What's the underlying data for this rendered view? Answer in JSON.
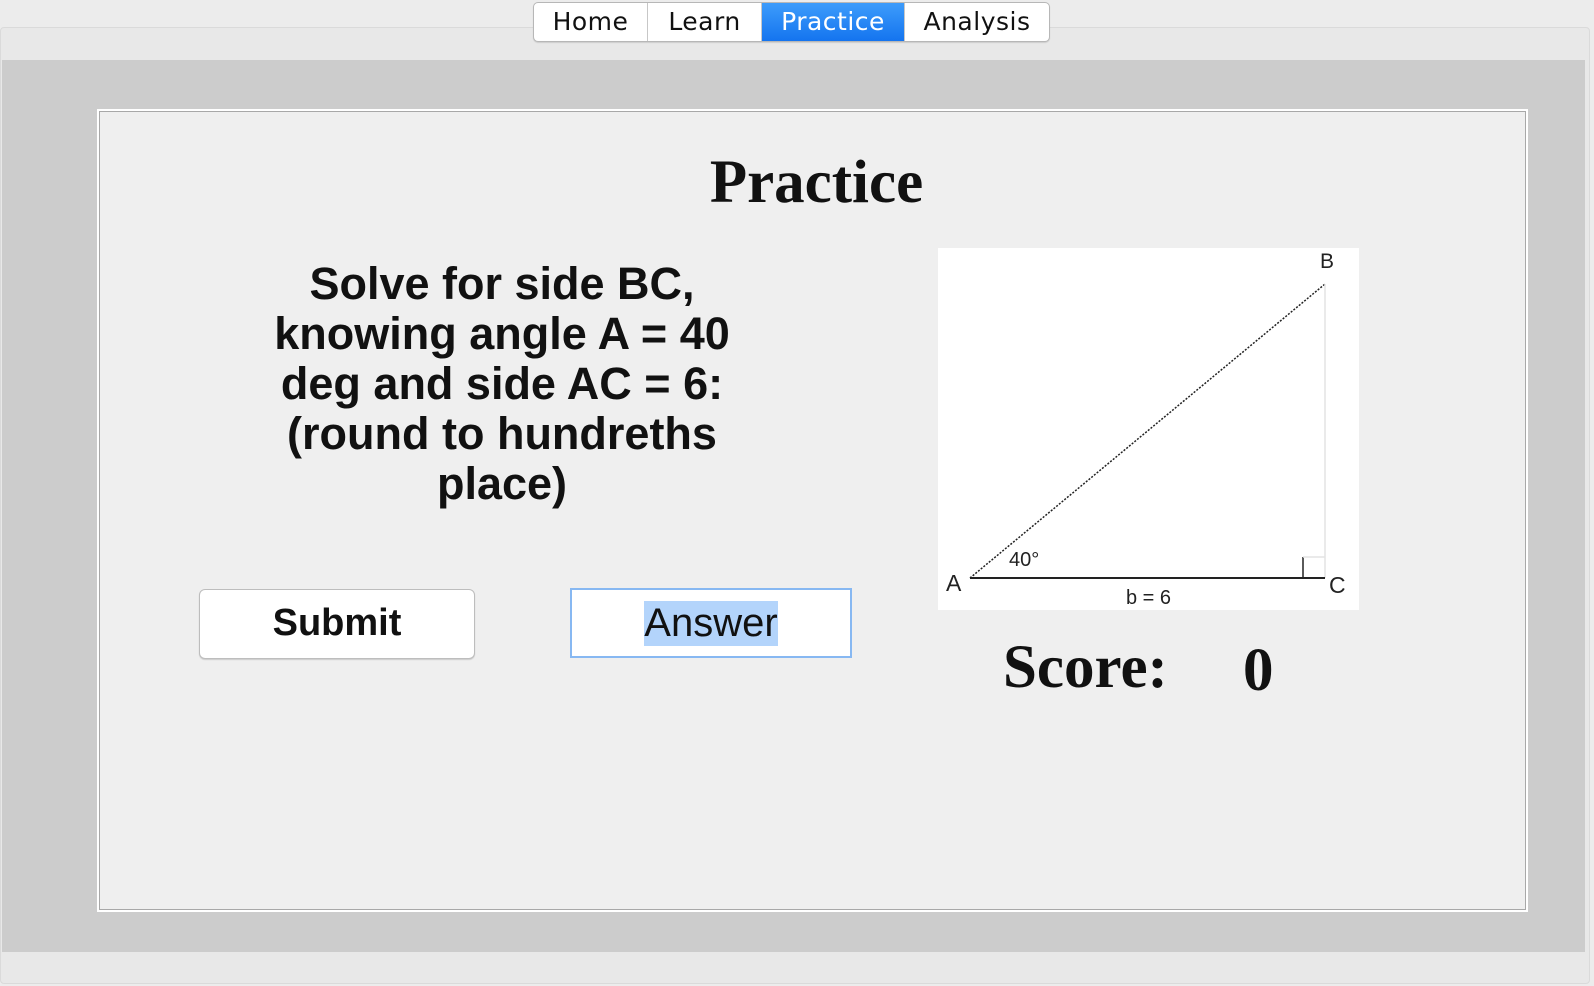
{
  "tabs": [
    {
      "label": "Home",
      "active": false
    },
    {
      "label": "Learn",
      "active": false
    },
    {
      "label": "Practice",
      "active": true
    },
    {
      "label": "Analysis",
      "active": false
    }
  ],
  "page": {
    "title": "Practice",
    "question": "Solve for side BC, knowing angle A = 40 deg and side AC = 6: (round to hundreths place)",
    "submit_label": "Submit",
    "answer_value": "Answer"
  },
  "triangle": {
    "vertex_a": "A",
    "vertex_b": "B",
    "vertex_c": "C",
    "angle_label": "40°",
    "side_label": "b = 6"
  },
  "score": {
    "label": "Score:",
    "value": "0"
  },
  "colors": {
    "tab_active": "#1474ef",
    "input_border": "#87b8f2",
    "panel_bg": "#efefef",
    "frame_gray": "#cccccc"
  }
}
